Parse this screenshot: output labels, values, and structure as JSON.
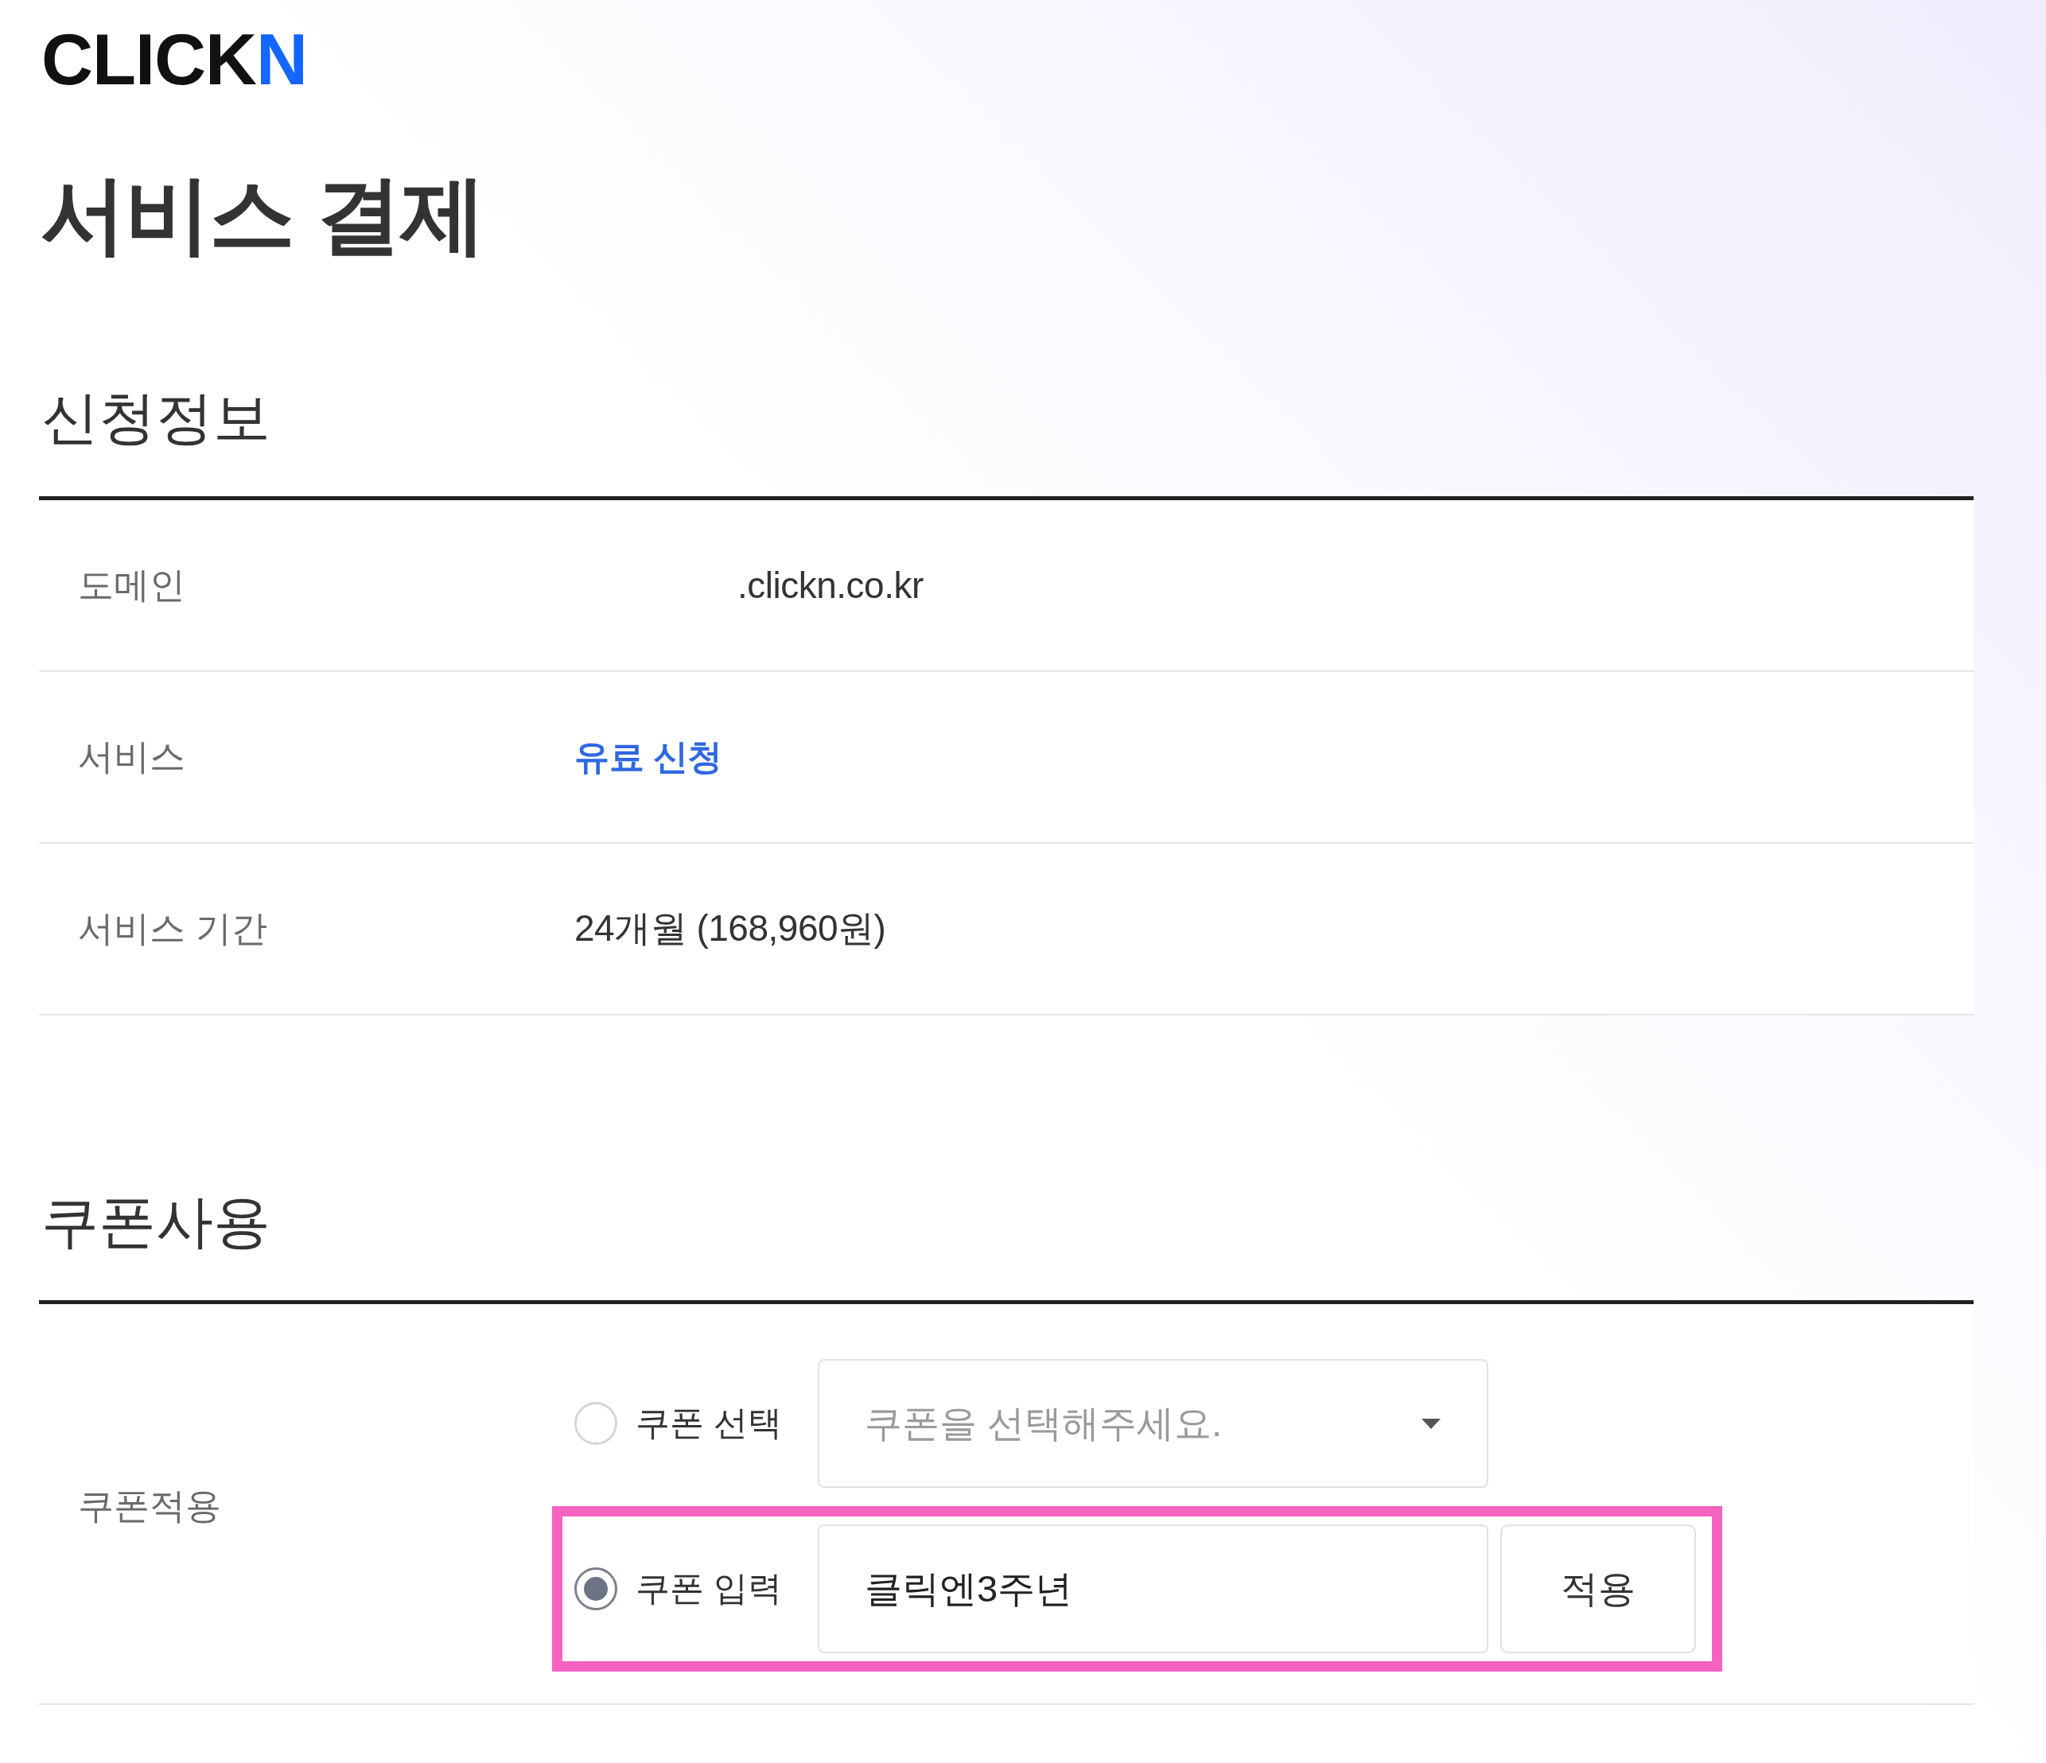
{
  "logo": {
    "text": "CLICK",
    "accent": "N"
  },
  "page_title": "서비스 결제",
  "application_info": {
    "heading": "신청정보",
    "rows": [
      {
        "label": "도메인",
        "value": ".clickn.co.kr",
        "kind": "domain"
      },
      {
        "label": "서비스",
        "value": "유료 신청",
        "kind": "accent"
      },
      {
        "label": "서비스 기간",
        "value": "24개월 (168,960원)",
        "kind": "plain"
      }
    ]
  },
  "coupon": {
    "heading": "쿠폰사용",
    "label": "쿠폰적용",
    "options": [
      {
        "kind": "select",
        "label": "쿠폰 선택",
        "selected": false,
        "highlighted": false,
        "placeholder": "쿠폰을 선택해주세요."
      },
      {
        "kind": "input",
        "label": "쿠폰 입력",
        "selected": true,
        "highlighted": true,
        "value": "클릭엔3주년",
        "button": "적용"
      }
    ]
  }
}
